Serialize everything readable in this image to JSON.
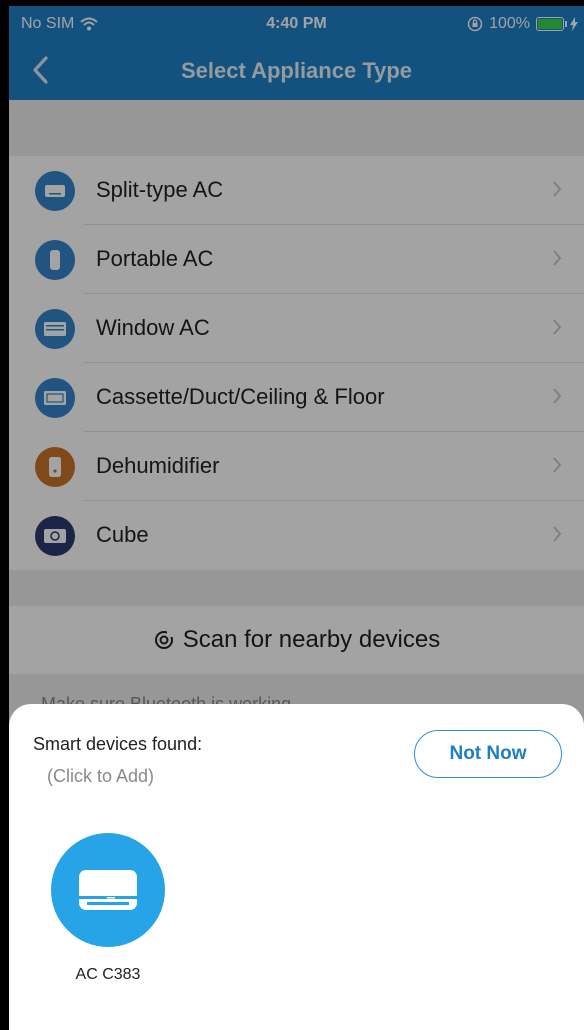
{
  "status_bar": {
    "carrier": "No SIM",
    "time": "4:40 PM",
    "battery": "100%"
  },
  "nav": {
    "title": "Select Appliance Type"
  },
  "appliances": [
    {
      "label": "Split-type AC",
      "icon": "split-ac-icon",
      "color": "#3584c8"
    },
    {
      "label": "Portable AC",
      "icon": "portable-ac-icon",
      "color": "#3584c8"
    },
    {
      "label": "Window AC",
      "icon": "window-ac-icon",
      "color": "#3584c8"
    },
    {
      "label": "Cassette/Duct/Ceiling & Floor",
      "icon": "cassette-icon",
      "color": "#3584c8"
    },
    {
      "label": "Dehumidifier",
      "icon": "dehumidifier-icon",
      "color": "#c9722a"
    },
    {
      "label": "Cube",
      "icon": "cube-icon",
      "color": "#2b3a6e"
    }
  ],
  "scan": {
    "label": "Scan for nearby devices"
  },
  "hint": {
    "text": "Make sure Bluetooth is working"
  },
  "sheet": {
    "title": "Smart devices found:",
    "subtitle": "(Click to Add)",
    "dismiss_label": "Not Now",
    "devices": [
      {
        "name": "AC C383",
        "icon": "ac-unit-icon"
      }
    ]
  },
  "colors": {
    "accent": "#1f7fc5",
    "device_blue": "#27a3e8"
  }
}
